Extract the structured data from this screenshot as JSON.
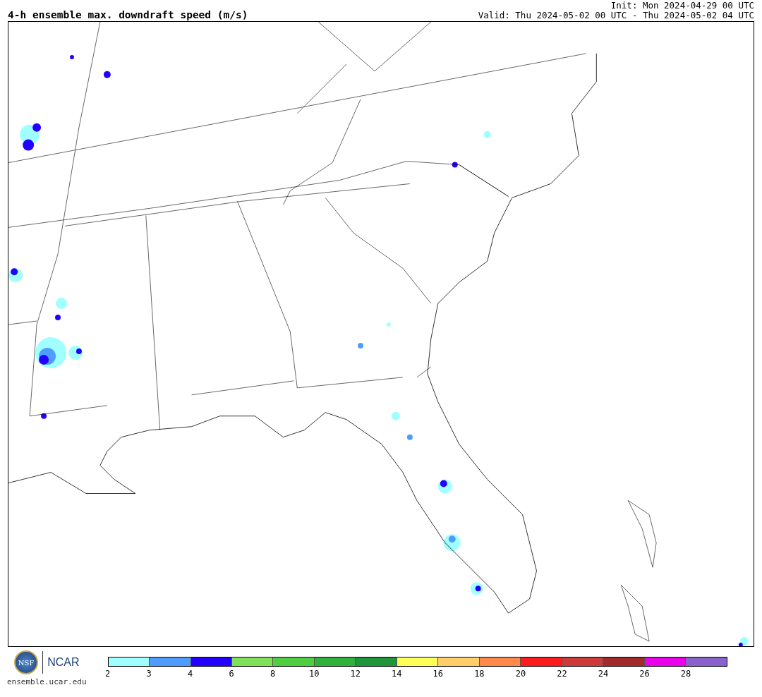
{
  "title": "4-h ensemble max. downdraft speed (m/s)",
  "init": "Init: Mon 2024-04-29 00 UTC",
  "valid": "Valid: Thu 2024-05-02 00 UTC - Thu 2024-05-02 04 UTC",
  "logo": {
    "nsf": "NSF",
    "ncar": "NCAR",
    "url": "ensemble.ucar.edu"
  },
  "colorbar": [
    {
      "label": "2",
      "color": "#a0ffff"
    },
    {
      "label": "3",
      "color": "#4f9cff"
    },
    {
      "label": "4",
      "color": "#2400ff"
    },
    {
      "label": "6",
      "color": "#7fe05a"
    },
    {
      "label": "8",
      "color": "#4fce42"
    },
    {
      "label": "10",
      "color": "#2fb23a"
    },
    {
      "label": "12",
      "color": "#1e9639"
    },
    {
      "label": "14",
      "color": "#ffff5a"
    },
    {
      "label": "16",
      "color": "#ffcd6a"
    },
    {
      "label": "18",
      "color": "#ff894a"
    },
    {
      "label": "20",
      "color": "#ff1c1c"
    },
    {
      "label": "22",
      "color": "#cc3a3a"
    },
    {
      "label": "24",
      "color": "#a22a2a"
    },
    {
      "label": "26",
      "color": "#ea00ea"
    },
    {
      "label": "28",
      "color": "#8a62cc"
    }
  ]
}
